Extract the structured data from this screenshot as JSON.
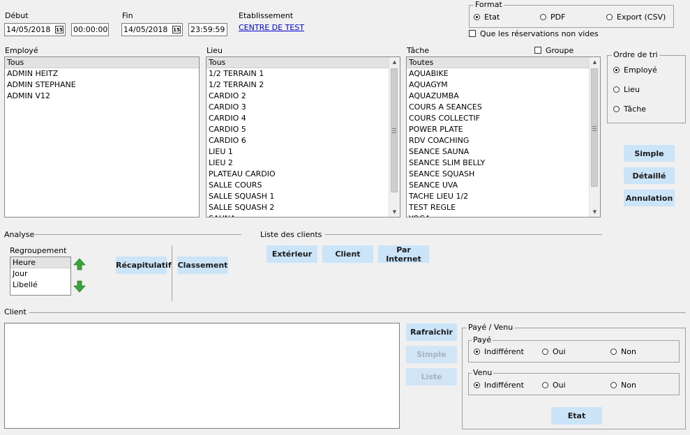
{
  "period": {
    "start_label": "Début",
    "start_date": "14/05/2018",
    "start_time": "00:00:00",
    "end_label": "Fin",
    "end_date": "14/05/2018",
    "end_time": "23:59:59",
    "calendar_glyph": "15"
  },
  "establishment": {
    "label": "Etablissement",
    "value": "CENTRE DE TEST"
  },
  "format": {
    "title": "Format",
    "options": [
      "Etat",
      "PDF",
      "Export (CSV)"
    ],
    "selected": "Etat",
    "nonempty_label": "Que les réservations non vides"
  },
  "employee": {
    "label": "Employé",
    "items": [
      "Tous",
      "ADMIN HEITZ",
      "ADMIN STEPHANE",
      "ADMIN V12"
    ]
  },
  "place": {
    "label": "Lieu",
    "items": [
      "Tous",
      "1/2 TERRAIN 1",
      "1/2 TERRAIN 2",
      "CARDIO 2",
      "CARDIO 3",
      "CARDIO 4",
      "CARDIO 5",
      "CARDIO 6",
      "LIEU 1",
      "LIEU 2",
      "PLATEAU CARDIO",
      "SALLE COURS",
      "SALLE SQUASH 1",
      "SALLE SQUASH 2",
      "SAUNA"
    ]
  },
  "task": {
    "label": "Tâche",
    "group_label": "Groupe",
    "items": [
      "Toutes",
      "AQUABIKE",
      "AQUAGYM",
      "AQUAZUMBA",
      "COURS A SEANCES",
      "COURS COLLECTIF",
      "POWER PLATE",
      "RDV COACHING",
      "SEANCE SAUNA",
      "SEANCE SLIM BELLY",
      "SEANCE SQUASH",
      "SEANCE UVA",
      "TACHE LIEU 1/2",
      "TEST REGLE",
      "YOGA"
    ]
  },
  "sort": {
    "title": "Ordre de tri",
    "options": [
      "Employé",
      "Lieu",
      "Tâche"
    ],
    "selected": "Employé"
  },
  "report_buttons": {
    "simple": "Simple",
    "detailed": "Détaillé",
    "cancellation": "Annulation"
  },
  "analysis": {
    "title": "Analyse",
    "grouping_label": "Regroupement",
    "grouping_items": [
      "Heure",
      "Jour",
      "Libellé"
    ],
    "recap_button": "Récapitulatif",
    "ranking_button": "Classement"
  },
  "clients_list": {
    "title": "Liste des clients",
    "buttons": [
      "Extérieur",
      "Client",
      "Par Internet"
    ]
  },
  "client": {
    "title": "Client",
    "refresh_button": "Rafraîchir",
    "simple_button": "Simple",
    "list_button": "Liste"
  },
  "paid_came": {
    "title": "Payé / Venu",
    "paid_title": "Payé",
    "came_title": "Venu",
    "options": [
      "Indifférent",
      "Oui",
      "Non"
    ],
    "selected": "Indifférent",
    "state_button": "Etat"
  },
  "colors": {
    "button_bg": "#cce4f7",
    "window_bg": "#f0f0f0",
    "link": "#0000cc"
  }
}
